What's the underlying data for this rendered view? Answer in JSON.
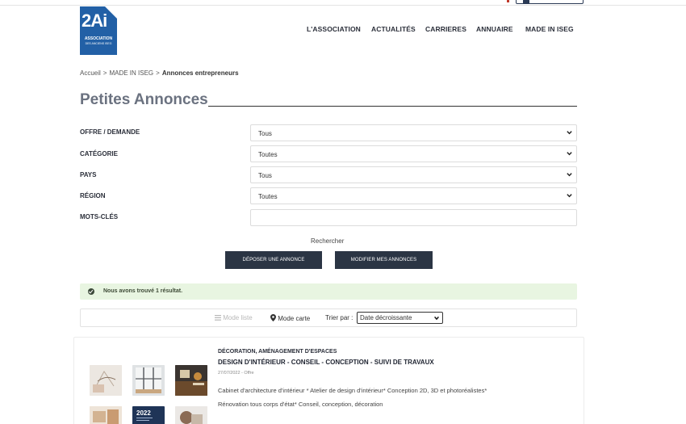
{
  "logo": {
    "main": "2Ai",
    "line1": "ASSOCIATION",
    "line2": "DES ANCIENS ISEG"
  },
  "nav": [
    "L'ASSOCIATION",
    "ACTUALITÉS",
    "CARRIERES",
    "ANNUAIRE",
    "MADE IN ISEG"
  ],
  "breadcrumb": {
    "items": [
      "Accueil",
      "MADE IN ISEG"
    ],
    "separator": ">",
    "current": "Annonces entrepreneurs"
  },
  "page_title": "Petites Annonces",
  "filters": [
    {
      "label": "OFFRE / DEMANDE",
      "value": "Tous"
    },
    {
      "label": "CATÉGORIE",
      "value": "Toutes"
    },
    {
      "label": "PAYS",
      "value": "Tous"
    },
    {
      "label": "RÉGION",
      "value": "Toutes"
    },
    {
      "label": "MOTS-CLÉS",
      "value": ""
    }
  ],
  "search_label": "Rechercher",
  "buttons": {
    "deposit": "DÉPOSER UNE ANNONCE",
    "modify": "MODIFIER MES ANNONCES"
  },
  "alert": "Nous avons trouvé 1 résultat.",
  "toolbar": {
    "list_mode": "Mode liste",
    "map_mode": "Mode carte",
    "sort_label": "Trier par :",
    "sort_value": "Date décroissante"
  },
  "ad": {
    "category": "DÉCORATION, AMÉNAGEMENT D'ESPACES",
    "title": "DESIGN D'INTÉRIEUR - CONSEIL - CONCEPTION - SUIVI DE TRAVAUX",
    "meta": "27/07/2022 - Offre",
    "desc1": "Cabinet d'architecture d'intérieur * Atelier de design d'intérieur* Conception 2D, 3D et photoréalistes*",
    "desc2": "Rénovation tous corps d'état* Conseil, conception, décoration",
    "thumb_text": "2022"
  },
  "colors": {
    "brand_blue": "#2260a6",
    "dark_button": "#2b3544",
    "alert_bg": "#e8f5e1"
  }
}
